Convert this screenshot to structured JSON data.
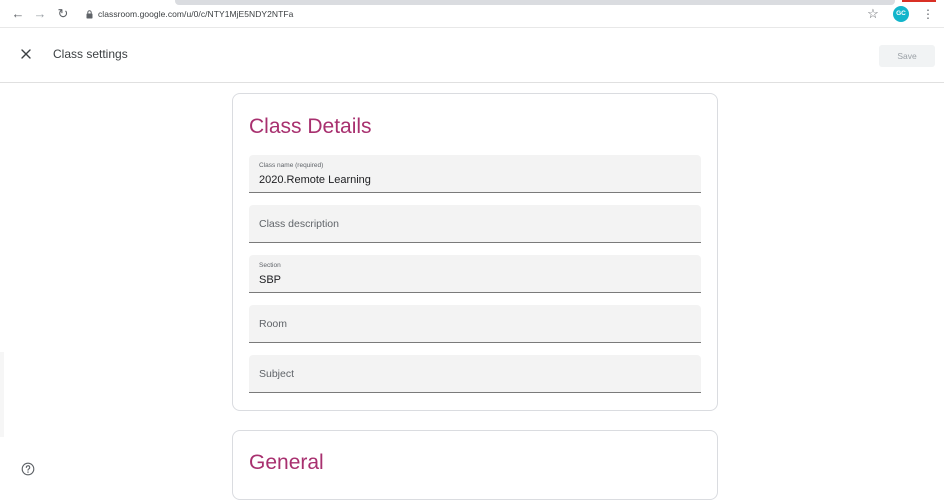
{
  "browser": {
    "url": "classroom.google.com/u/0/c/NTY1MjE5NDY2NTFa",
    "profile_initials": "GC",
    "icons": [
      "back-arrow-icon",
      "forward-arrow-icon",
      "reload-icon",
      "lock-icon",
      "star-icon",
      "kebab-menu-icon"
    ]
  },
  "header": {
    "title": "Class settings",
    "save_label": "Save",
    "icons": [
      "close-icon"
    ]
  },
  "class_details": {
    "heading": "Class Details",
    "fields": [
      {
        "label": "Class name (required)",
        "value": "2020.Remote Learning",
        "placeholder": ""
      },
      {
        "label": "",
        "value": "",
        "placeholder": "Class description"
      },
      {
        "label": "Section",
        "value": "SBP",
        "placeholder": ""
      },
      {
        "label": "",
        "value": "",
        "placeholder": "Room"
      },
      {
        "label": "",
        "value": "",
        "placeholder": "Subject"
      }
    ]
  },
  "general": {
    "heading": "General"
  },
  "footer": {
    "icons": [
      "help-icon"
    ]
  },
  "colors": {
    "accent": "#a8306f",
    "field_bg": "#f3f3f3",
    "card_border": "#dadce0",
    "avatar": "#12b5cb"
  }
}
